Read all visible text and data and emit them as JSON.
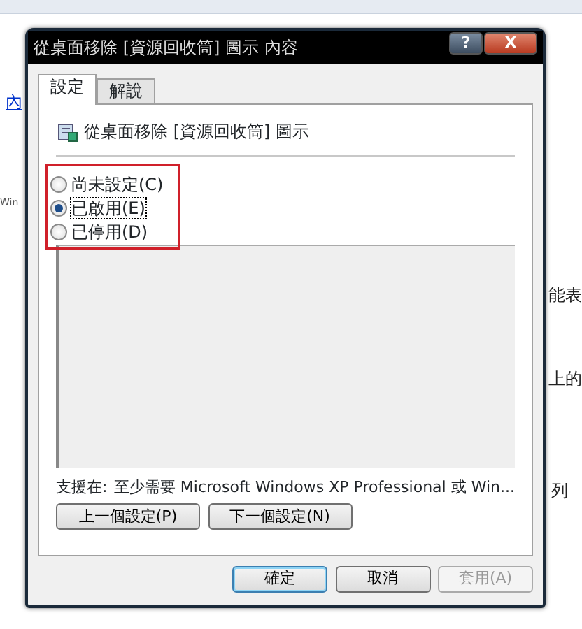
{
  "background_texts": [
    {
      "text": "內",
      "kind": "link"
    },
    {
      "text": "Win",
      "kind": "plain"
    },
    {
      "text": "能表",
      "kind": "plain"
    },
    {
      "text": "上的",
      "kind": "plain"
    },
    {
      "text": "列",
      "kind": "plain"
    }
  ],
  "window": {
    "title": "從桌面移除 [資源回收筒] 圖示 內容",
    "help": "?",
    "close": "X"
  },
  "tabs": [
    {
      "label": "設定",
      "selected": true
    },
    {
      "label": "解說",
      "selected": false
    }
  ],
  "policy": {
    "name": "從桌面移除 [資源回收筒] 圖示"
  },
  "options": [
    {
      "label": "尚未設定(C)",
      "selected": false
    },
    {
      "label": "已啟用(E)",
      "selected": true
    },
    {
      "label": "已停用(D)",
      "selected": false
    }
  ],
  "supported": {
    "label": "支援在:",
    "value": "至少需要 Microsoft Windows XP Professional 或 Win..."
  },
  "nav_buttons": [
    {
      "label": "上一個設定(P)",
      "disabled": false
    },
    {
      "label": "下一個設定(N)",
      "disabled": false
    }
  ],
  "buttons": [
    {
      "label": "確定",
      "disabled": false,
      "default": true
    },
    {
      "label": "取消",
      "disabled": false,
      "default": false
    },
    {
      "label": "套用(A)",
      "disabled": true,
      "default": false
    }
  ]
}
